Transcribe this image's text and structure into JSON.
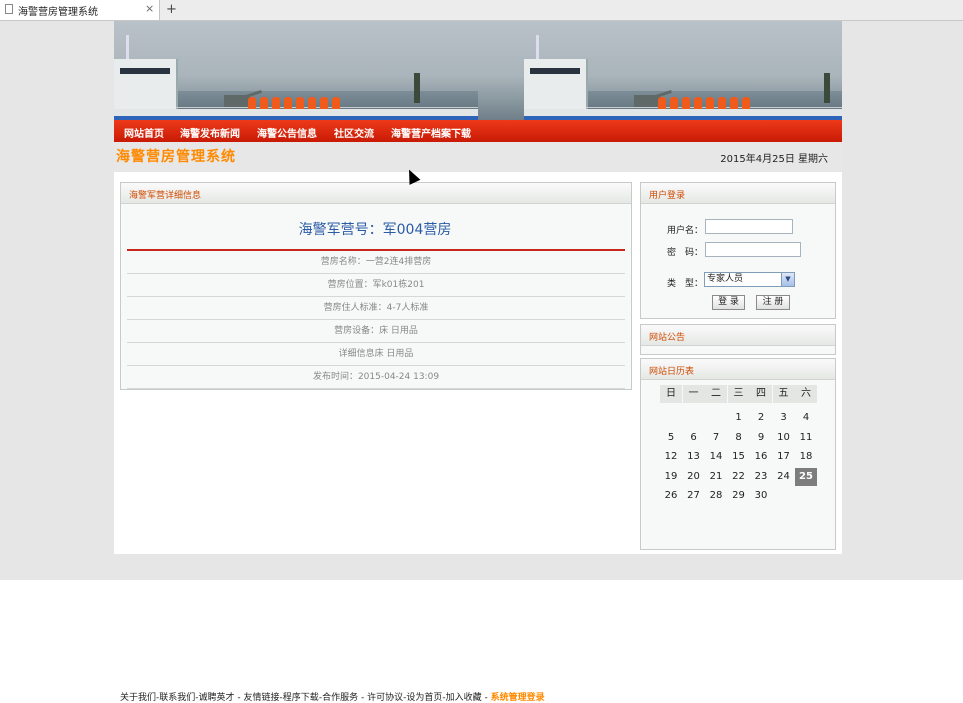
{
  "browser": {
    "tab_title": "海警营房管理系统",
    "close_glyph": "×",
    "new_tab_glyph": "+"
  },
  "nav": [
    "网站首页",
    "海警发布新闻",
    "海警公告信息",
    "社区交流",
    "海警营产档案下载"
  ],
  "header": {
    "site_title": "海警营房管理系统",
    "date": "2015年4月25日 星期六"
  },
  "detail": {
    "panel_title": "海警军营详细信息",
    "heading": "海警军营号：军004营房",
    "rows": [
      "营房名称：一营2连4排营房",
      "营房位置：军k01栋201",
      "营房住人标准：4-7人标准",
      "营房设备：床 日用品",
      "详细信息床 日用品",
      "发布时间：2015-04-24 13:09"
    ]
  },
  "login": {
    "panel_title": "用户登录",
    "username_label": "用户名：",
    "password_label": "密　码：",
    "type_label": "类　型：",
    "type_value": "专家人员",
    "login_button": "登 录",
    "register_button": "注 册"
  },
  "notice": {
    "panel_title": "网站公告"
  },
  "calendar": {
    "panel_title": "网站日历表",
    "weekdays": [
      "日",
      "一",
      "二",
      "三",
      "四",
      "五",
      "六"
    ],
    "weeks": [
      [
        "",
        "",
        "",
        "1",
        "2",
        "3",
        "4"
      ],
      [
        "5",
        "6",
        "7",
        "8",
        "9",
        "10",
        "11"
      ],
      [
        "12",
        "13",
        "14",
        "15",
        "16",
        "17",
        "18"
      ],
      [
        "19",
        "20",
        "21",
        "22",
        "23",
        "24",
        "25"
      ],
      [
        "26",
        "27",
        "28",
        "29",
        "30",
        "",
        ""
      ]
    ],
    "today": "25"
  },
  "footer": {
    "links": [
      "关于我们",
      "联系我们",
      "诚聘英才",
      "友情链接",
      "程序下载",
      "合作服务",
      "许可协议",
      "设为首页",
      "加入收藏"
    ],
    "separators": [
      "-",
      "-",
      " - ",
      "-",
      "-",
      " - ",
      "-",
      "-",
      " - "
    ],
    "admin_link": "系统管理登录"
  }
}
